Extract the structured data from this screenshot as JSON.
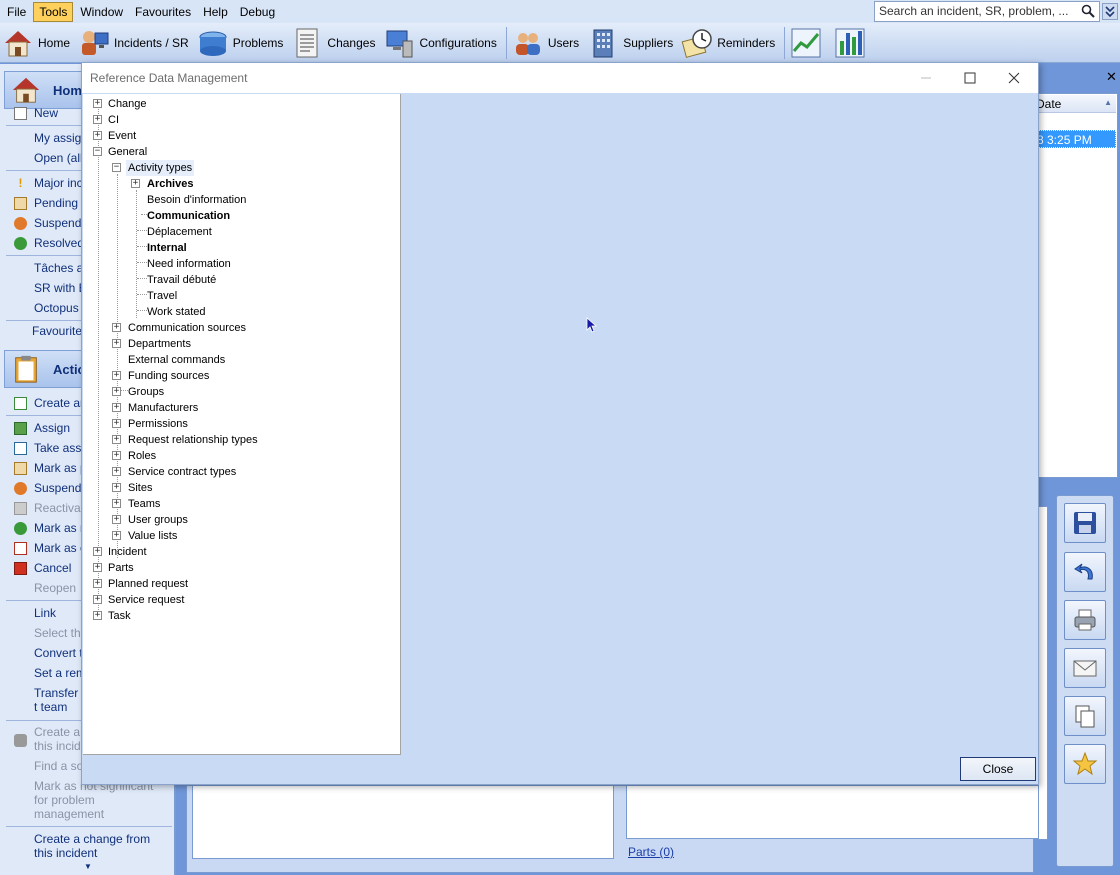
{
  "menubar": {
    "items": [
      "File",
      "Tools",
      "Window",
      "Favourites",
      "Help",
      "Debug"
    ],
    "active_item": "Tools",
    "search_placeholder": "Search an incident, SR, problem, ..."
  },
  "toolbar": {
    "home": "Home",
    "incidents": "Incidents / SR",
    "problems": "Problems",
    "changes": "Changes",
    "configurations": "Configurations",
    "users": "Users",
    "suppliers": "Suppliers",
    "reminders": "Reminders"
  },
  "sidebar": {
    "home_header": "Home",
    "home_items": {
      "new": "New",
      "my_assigned": "My assig",
      "open_all": "Open (all",
      "major": "Major inc",
      "pending": "Pending",
      "suspended": "Suspende",
      "resolved": "Resolved",
      "taches": "Tâches ac",
      "sr_with": "SR with E",
      "octopus": "Octopus",
      "favourites": "Favourites"
    },
    "actions_header": "Actio",
    "action_items": {
      "create": "Create ar",
      "assign": "Assign",
      "take_assign": "Take assig",
      "mark_as_p": "Mark as p",
      "suspend": "Suspend",
      "reactivate": "Reactivat",
      "mark_as_r": "Mark as r",
      "mark_as_c": "Mark as c",
      "cancel": "Cancel",
      "reopen": "Reopen",
      "link": "Link",
      "select_the": "Select the",
      "convert": "Convert t",
      "set_reminder": "Set a rem",
      "transfer": "Transfer t team",
      "create_this": "Create a this incid",
      "find_solution": "Find a so",
      "mark_not_significant": "Mark as not significant for problem management",
      "create_change": "Create a change from this incident"
    }
  },
  "background": {
    "date_header": "Date",
    "selected_row_time": "8 3:25 PM",
    "parts_link": "Parts (0)"
  },
  "dialog": {
    "title": "Reference Data Management",
    "close_button": "Close",
    "tree": {
      "change": "Change",
      "ci": "CI",
      "event": "Event",
      "general": "General",
      "activity_types": "Activity types",
      "archives": "Archives",
      "besoin": "Besoin d'information",
      "communication": "Communication",
      "deplacement": "Déplacement",
      "internal": "Internal",
      "need_information": "Need information",
      "travail_debute": "Travail débuté",
      "travel": "Travel",
      "work_stated": "Work stated",
      "communication_sources": "Communication sources",
      "departments": "Departments",
      "external_commands": "External commands",
      "funding_sources": "Funding sources",
      "groups": "Groups",
      "manufacturers": "Manufacturers",
      "permissions": "Permissions",
      "request_relationship_types": "Request relationship types",
      "roles": "Roles",
      "service_contract_types": "Service contract types",
      "sites": "Sites",
      "teams": "Teams",
      "user_groups": "User groups",
      "value_lists": "Value lists",
      "incident": "Incident",
      "parts": "Parts",
      "planned_request": "Planned request",
      "service_request": "Service request",
      "task": "Task"
    }
  }
}
